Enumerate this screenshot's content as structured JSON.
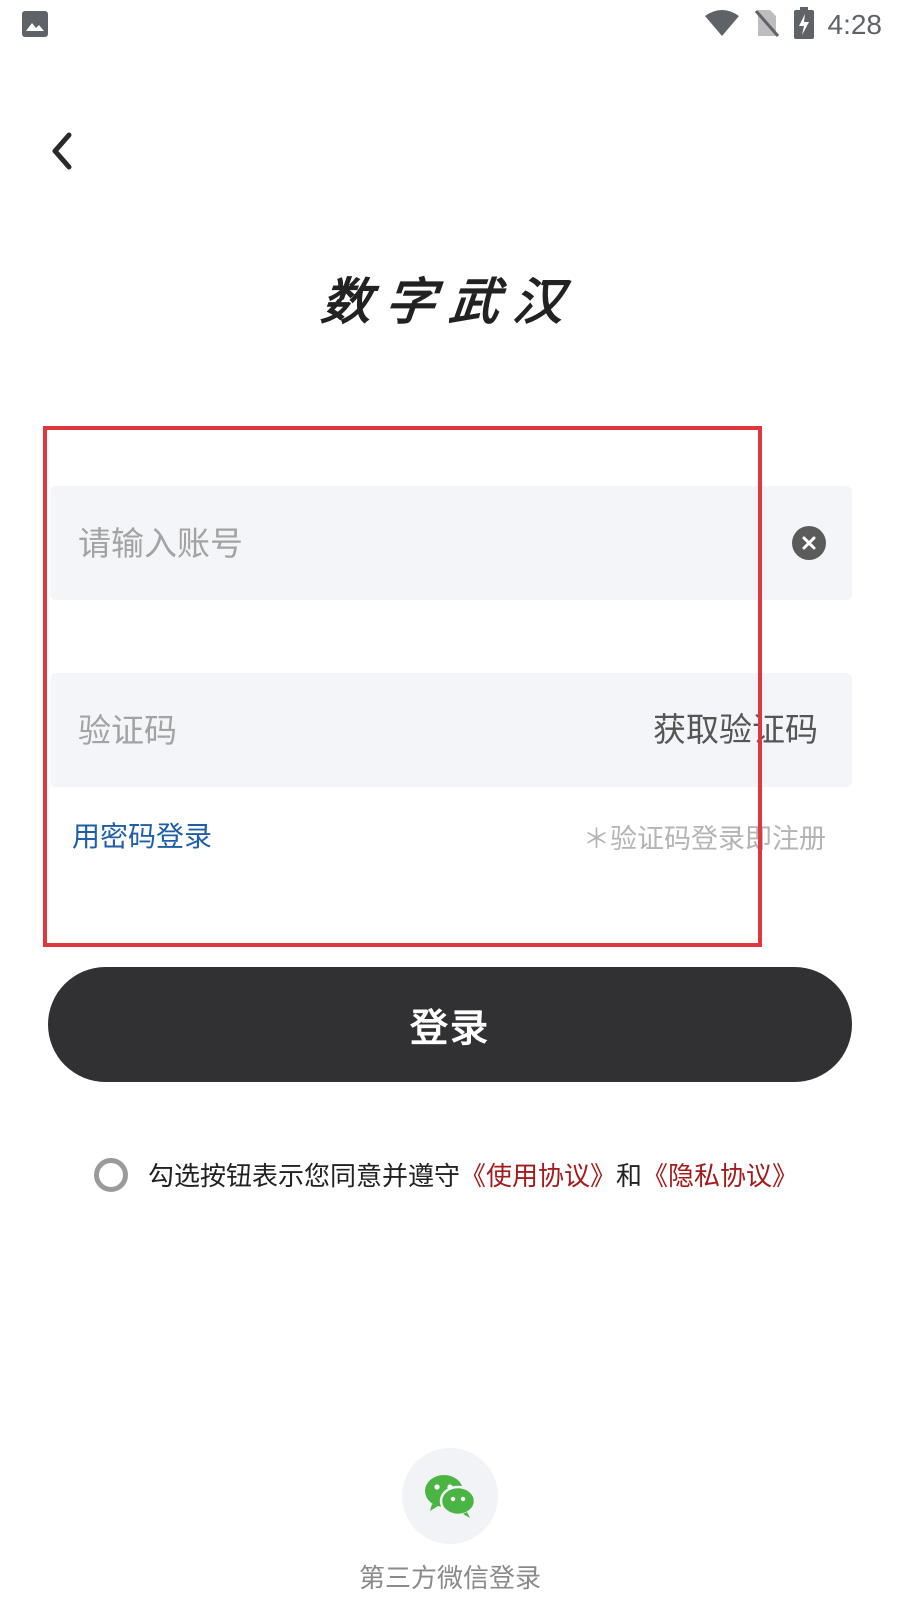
{
  "status_bar": {
    "time": "4:28"
  },
  "logo": {
    "text": "数字武汉"
  },
  "account_field": {
    "placeholder": "请输入账号",
    "value": ""
  },
  "code_field": {
    "placeholder": "验证码",
    "value": "",
    "get_code_label": "获取验证码"
  },
  "password_login_link": "用密码登录",
  "register_hint": "＊验证码登录即注册",
  "login_button": "登录",
  "agreement": {
    "prefix": "勾选按钮表示您同意并遵守",
    "terms_link": "《使用协议》",
    "conjunction": "和",
    "privacy_link": "《隐私协议》",
    "checked": false
  },
  "wechat": {
    "label": "第三方微信登录",
    "icon": "wechat-icon"
  },
  "colors": {
    "primary_button": "#313133",
    "link_blue": "#1e5fa8",
    "link_red": "#a31b1b",
    "annotation_red": "#e0373e",
    "field_bg": "#f4f5f9"
  }
}
